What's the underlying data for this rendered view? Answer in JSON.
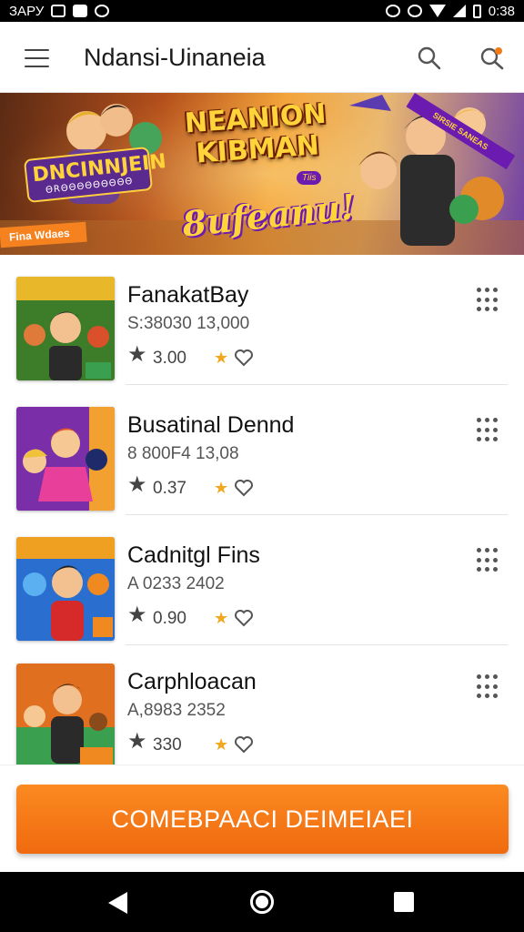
{
  "status_bar": {
    "left_text": "ЗАРУ",
    "time": "0:38"
  },
  "app_bar": {
    "title": "Ndansi-Uinaneia"
  },
  "banner": {
    "left_title": "DNCINNJEIN",
    "left_subtitle": "ΘRΘΘΘΘΘΘΘΘΘ",
    "left_tag": "Fina Wdaes",
    "title": "NEANION KIBMAN",
    "badge": "Tiis",
    "script_text": "8ufeanu!",
    "ribbon": "SIRSIE SANEAS"
  },
  "games": [
    {
      "title": "FanakatBay",
      "subtitle": "S:38030 13,000",
      "rating": "3.00",
      "palette": [
        "#3d7d2a",
        "#e8b82a"
      ]
    },
    {
      "title": "Busatinal Dennd",
      "subtitle": "8 800F4 13,08",
      "rating": "0.37",
      "palette": [
        "#7a2fa8",
        "#f2a030"
      ]
    },
    {
      "title": "Cadnitgl Fins",
      "subtitle": "A 0233 2402",
      "rating": "0.90",
      "palette": [
        "#2a6fcf",
        "#f08a20"
      ]
    },
    {
      "title": "Carphloacan",
      "subtitle": "A,8983 2352",
      "rating": "330",
      "palette": [
        "#e07020",
        "#3aa050"
      ]
    }
  ],
  "cta": {
    "label": "COMEBPAACI DEIMEIAEI"
  },
  "colors": {
    "accent": "#f27a17",
    "star": "#f0a820",
    "text_primary": "#111111",
    "text_secondary": "#555555"
  }
}
